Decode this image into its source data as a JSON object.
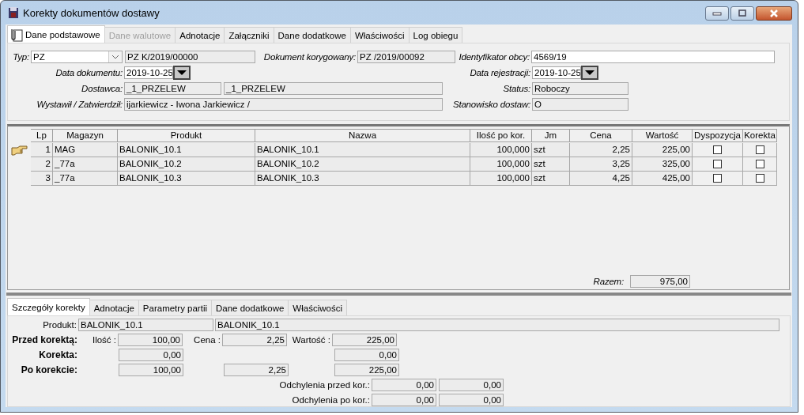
{
  "window": {
    "title": "Korekty dokumentów dostawy"
  },
  "tabs": [
    {
      "label": "Dane podstawowe",
      "selected": true,
      "disabled": false
    },
    {
      "label": "Dane walutowe",
      "selected": false,
      "disabled": true
    },
    {
      "label": "Adnotacje",
      "selected": false,
      "disabled": false
    },
    {
      "label": "Załączniki",
      "selected": false,
      "disabled": false
    },
    {
      "label": "Dane dodatkowe",
      "selected": false,
      "disabled": false
    },
    {
      "label": "Właściwości",
      "selected": false,
      "disabled": false
    },
    {
      "label": "Log obiegu",
      "selected": false,
      "disabled": false
    }
  ],
  "header": {
    "typ": {
      "label": "Typ:",
      "value": "PZ"
    },
    "numer": "PZ  K/2019/00000",
    "dokument_korygowany": {
      "label": "Dokument korygowany:",
      "value": "PZ   /2019/00092"
    },
    "identyfikator_obcy": {
      "label": "Identyfikator obcy:",
      "value": "4569/19"
    },
    "data_dokumentu": {
      "label": "Data dokumentu:",
      "value": "2019-10-25"
    },
    "data_rejestracji": {
      "label": "Data rejestracji:",
      "value": "2019-10-25"
    },
    "dostawca": {
      "label": "Dostawca:",
      "code": "_1_PRZELEW",
      "name": "_1_PRZELEW"
    },
    "status": {
      "label": "Status:",
      "value": "Roboczy"
    },
    "wystawil": {
      "label": "Wystawił / Zatwierdził:",
      "value": "ijarkiewicz - Iwona Jarkiewicz  /"
    },
    "stanowisko": {
      "label": "Stanowisko dostaw:",
      "value": "O"
    }
  },
  "table": {
    "columns": [
      "Lp",
      "Magazyn",
      "Produkt",
      "Nazwa",
      "Ilość po kor.",
      "Jm",
      "Cena",
      "Wartość",
      "Dyspozycja",
      "Korekta"
    ],
    "rows": [
      {
        "selected": true,
        "lp": "1",
        "magazyn": "MAG",
        "produkt": "BALONIK_10.1",
        "nazwa": "BALONIK_10.1",
        "ilosc": "100,000",
        "jm": "szt",
        "cena": "2,25",
        "wartosc": "225,00",
        "dyspozycja": false,
        "korekta": false
      },
      {
        "selected": false,
        "lp": "2",
        "magazyn": "_77a",
        "produkt": "BALONIK_10.2",
        "nazwa": "BALONIK_10.2",
        "ilosc": "100,000",
        "jm": "szt",
        "cena": "3,25",
        "wartosc": "325,00",
        "dyspozycja": false,
        "korekta": false
      },
      {
        "selected": false,
        "lp": "3",
        "magazyn": "_77a",
        "produkt": "BALONIK_10.3",
        "nazwa": "BALONIK_10.3",
        "ilosc": "100,000",
        "jm": "szt",
        "cena": "4,25",
        "wartosc": "425,00",
        "dyspozycja": false,
        "korekta": false
      }
    ],
    "total": {
      "label": "Razem:",
      "value": "975,00"
    }
  },
  "detail_tabs": [
    {
      "label": "Szczegóły korekty",
      "selected": true
    },
    {
      "label": "Adnotacje",
      "selected": false
    },
    {
      "label": "Parametry partii",
      "selected": false
    },
    {
      "label": "Dane dodatkowe",
      "selected": false
    },
    {
      "label": "Właściwości",
      "selected": false
    }
  ],
  "detail": {
    "produkt": {
      "label": "Produkt:",
      "code": "BALONIK_10.1",
      "name": "BALONIK_10.1"
    },
    "przed": {
      "label": "Przed korektą:",
      "ilosc_label": "Ilość :",
      "ilosc": "100,00",
      "cena_label": "Cena :",
      "cena": "2,25",
      "wartosc_label": "Wartość :",
      "wartosc": "225,00"
    },
    "korekta": {
      "label": "Korekta:",
      "ilosc": "0,00",
      "wartosc": "0,00"
    },
    "po": {
      "label": "Po korekcie:",
      "ilosc": "100,00",
      "cena": "2,25",
      "wartosc": "225,00"
    },
    "odchylenia": [
      {
        "label": "Odchylenia przed kor.:",
        "value_1": "0,00",
        "value_2": "0,00"
      },
      {
        "label": "Odchylenia po kor.:",
        "value_1": "0,00",
        "value_2": "0,00"
      }
    ]
  }
}
